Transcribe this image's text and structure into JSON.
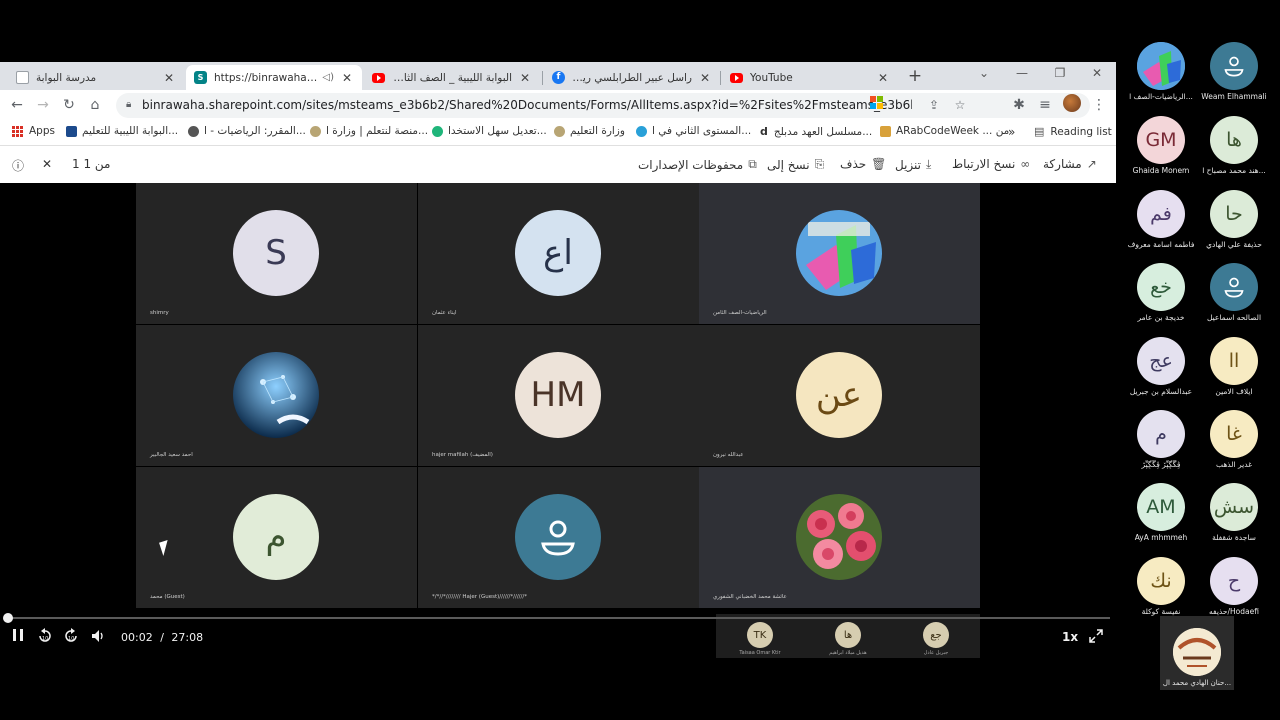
{
  "browser": {
    "tabs": [
      {
        "title": "مدرسة البوابة",
        "icon": "doc-icon"
      },
      {
        "title": "https://binrawaha.sharep",
        "icon": "sharepoint-icon"
      },
      {
        "title": "البوابة الليبية _ الصف الثامن -",
        "icon": "youtube-icon"
      },
      {
        "title": "راسل عبير الطرابلسي رياضيات",
        "icon": "facebook-icon"
      },
      {
        "title": "YouTube",
        "icon": "youtube-icon"
      }
    ],
    "url": "binrawaha.sharepoint.com/sites/msteams_e3b6b2/Shared%20Documents/Forms/AllItems.aspx?id=%2Fsites%2Fmsteams_e3b6b2%2FShared%20Docum...",
    "bookmarks": [
      {
        "label": "Apps"
      },
      {
        "label": "البوابة الليبية للتعليم..."
      },
      {
        "label": "المقرر: الرياضيات - ا..."
      },
      {
        "label": "منصة لنتعلم | وزارة ا..."
      },
      {
        "label": "تعديل سهل الاستخدا..."
      },
      {
        "label": "وزارة التعليم"
      },
      {
        "label": "المستوى الثاني في ا..."
      },
      {
        "label": "مسلسل العهد مدبلج..."
      },
      {
        "label": "ARabCodeWeek ... من"
      },
      {
        "label": "»"
      },
      {
        "label": "Reading list"
      }
    ],
    "colors": {
      "tabstrip": "#dee1e6",
      "omnibox": "#f1f3f4"
    }
  },
  "sharepoint": {
    "page_count": "1 من 1",
    "commands": [
      "مشاركة",
      "نسخ الارتباط",
      "تنزيل",
      "حذف",
      "نسخ إلى",
      "محفوظات الإصدارات"
    ]
  },
  "grid": [
    {
      "initials": "S",
      "name": "shimry",
      "bg": "#e1dfea",
      "fg": "#3a3a55"
    },
    {
      "initials": "اع",
      "name": "ايناء عثمان",
      "bg": "#d4e2f0",
      "fg": "#27324a"
    },
    {
      "initials": "",
      "name": "الرياضيات-الصف الثامن",
      "bg": "#4a90d9",
      "fg": "#fff"
    },
    {
      "initials": "",
      "name": "احمد سعيد الجالبير",
      "bg": "#2a5f8c",
      "fg": "#fff"
    },
    {
      "initials": "HM",
      "name": "hajer mafilah (المضيف)",
      "bg": "#ede3d9",
      "fg": "#4a3428"
    },
    {
      "initials": "عن",
      "name": "عبدالله نيرون",
      "bg": "#f5e6c0",
      "fg": "#6b4a14"
    },
    {
      "initials": "م",
      "name": "محمد (Guest)",
      "bg": "#e1ecd8",
      "fg": "#3c5530"
    },
    {
      "initials": "",
      "name": "*/*//*//////// Hajer (Guest)//////*//////*",
      "bg": "#3d7a94",
      "fg": "#fff"
    },
    {
      "initials": "",
      "name": "عائشة محمد الخضباني الشفوري",
      "bg": "#d97a8a",
      "fg": "#fff"
    }
  ],
  "roster": [
    {
      "initials": "",
      "name": "الرياضيات-الصف ا...",
      "bg": "#4a90d9",
      "fg": "#fff"
    },
    {
      "initials": "",
      "name": "Weam Elhammali",
      "bg": "#3d7a94",
      "fg": "#fff"
    },
    {
      "initials": "GM",
      "name": "Ghaida Monem",
      "bg": "#f3d6d9",
      "fg": "#7a2a36"
    },
    {
      "initials": "ها",
      "name": "هند محمد مصباح ا...",
      "bg": "#dcebd8",
      "fg": "#3c5530"
    },
    {
      "initials": "فم",
      "name": "فاطمه اسامة معروف",
      "bg": "#e6dff0",
      "fg": "#4b3a6a"
    },
    {
      "initials": "حا",
      "name": "حذيفة علي الهادي",
      "bg": "#dcebd8",
      "fg": "#3c5530"
    },
    {
      "initials": "خع",
      "name": "خديجة بن عامر",
      "bg": "#d7eede",
      "fg": "#2e5a3a"
    },
    {
      "initials": "",
      "name": "الصالحه اسماعيل",
      "bg": "#3d7a94",
      "fg": "#fff"
    },
    {
      "initials": "عج",
      "name": "عبدالسلام بن جبريل",
      "bg": "#e4e1ef",
      "fg": "#3e3a60"
    },
    {
      "initials": "اا",
      "name": "ايلاف الامين",
      "bg": "#f7ebc2",
      "fg": "#6e5316"
    },
    {
      "initials": "م",
      "name": "ڤِڴِّڲِپِّڒ ڤِڴِّڲِپِّڒ",
      "bg": "#e4e1ef",
      "fg": "#3e3a60"
    },
    {
      "initials": "غا",
      "name": "غدير الذهب",
      "bg": "#f7ebc2",
      "fg": "#6e5316"
    },
    {
      "initials": "AM",
      "name": "AyA mhmmeh",
      "bg": "#d7eede",
      "fg": "#2e5a3a"
    },
    {
      "initials": "سش",
      "name": "ساجدة شقفلة",
      "bg": "#dcebd8",
      "fg": "#3c5530"
    },
    {
      "initials": "نك",
      "name": "نفيسة كوكلة",
      "bg": "#f7ebc2",
      "fg": "#6e5316"
    },
    {
      "initials": "ح",
      "name": "حذيفه/Hodaefi",
      "bg": "#e6dff0",
      "fg": "#4b3a6a"
    }
  ],
  "bottom_strip": [
    {
      "initials": "TK",
      "name": "Taisaa Omar Ktir",
      "bg": "#d6cdb0"
    },
    {
      "initials": "ها",
      "name": "هديل ميلاد ابراهيم",
      "bg": "#d6cdb0"
    },
    {
      "initials": "جع",
      "name": "جبريل عادل",
      "bg": "#d6cdb0"
    }
  ],
  "selfview": {
    "name": "حنان الهادي محمد ال..."
  },
  "player": {
    "current_time": "00:02",
    "separator": "/",
    "duration": "27:08",
    "speed": "1x",
    "progress_fraction": 0.001
  }
}
